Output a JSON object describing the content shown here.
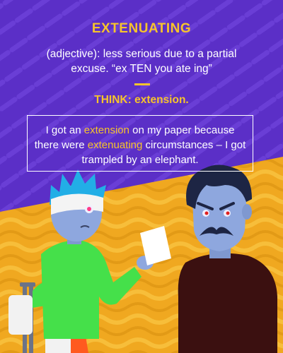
{
  "card": {
    "word": "EXTENUATING",
    "definition": "(adjective): less serious due to a partial excuse. “ex TEN you ate ing”",
    "think": "THINK: extension.",
    "example": {
      "part1": "I got an ",
      "highlight1": "extension",
      "part2": " on my paper because there were ",
      "highlight2": "extenuating",
      "part3": " circumstances – I got trampled by an elephant."
    }
  },
  "colors": {
    "background_purple": "#5b2fc7",
    "accent_yellow": "#f7c42b",
    "wave_orange": "#f0a820"
  },
  "illustration": {
    "characters": [
      "bandaged-man-with-crutch",
      "mustached-man-frowning"
    ],
    "icons": [
      "paper-note-icon",
      "crutch-icon",
      "bandage-icon"
    ]
  }
}
